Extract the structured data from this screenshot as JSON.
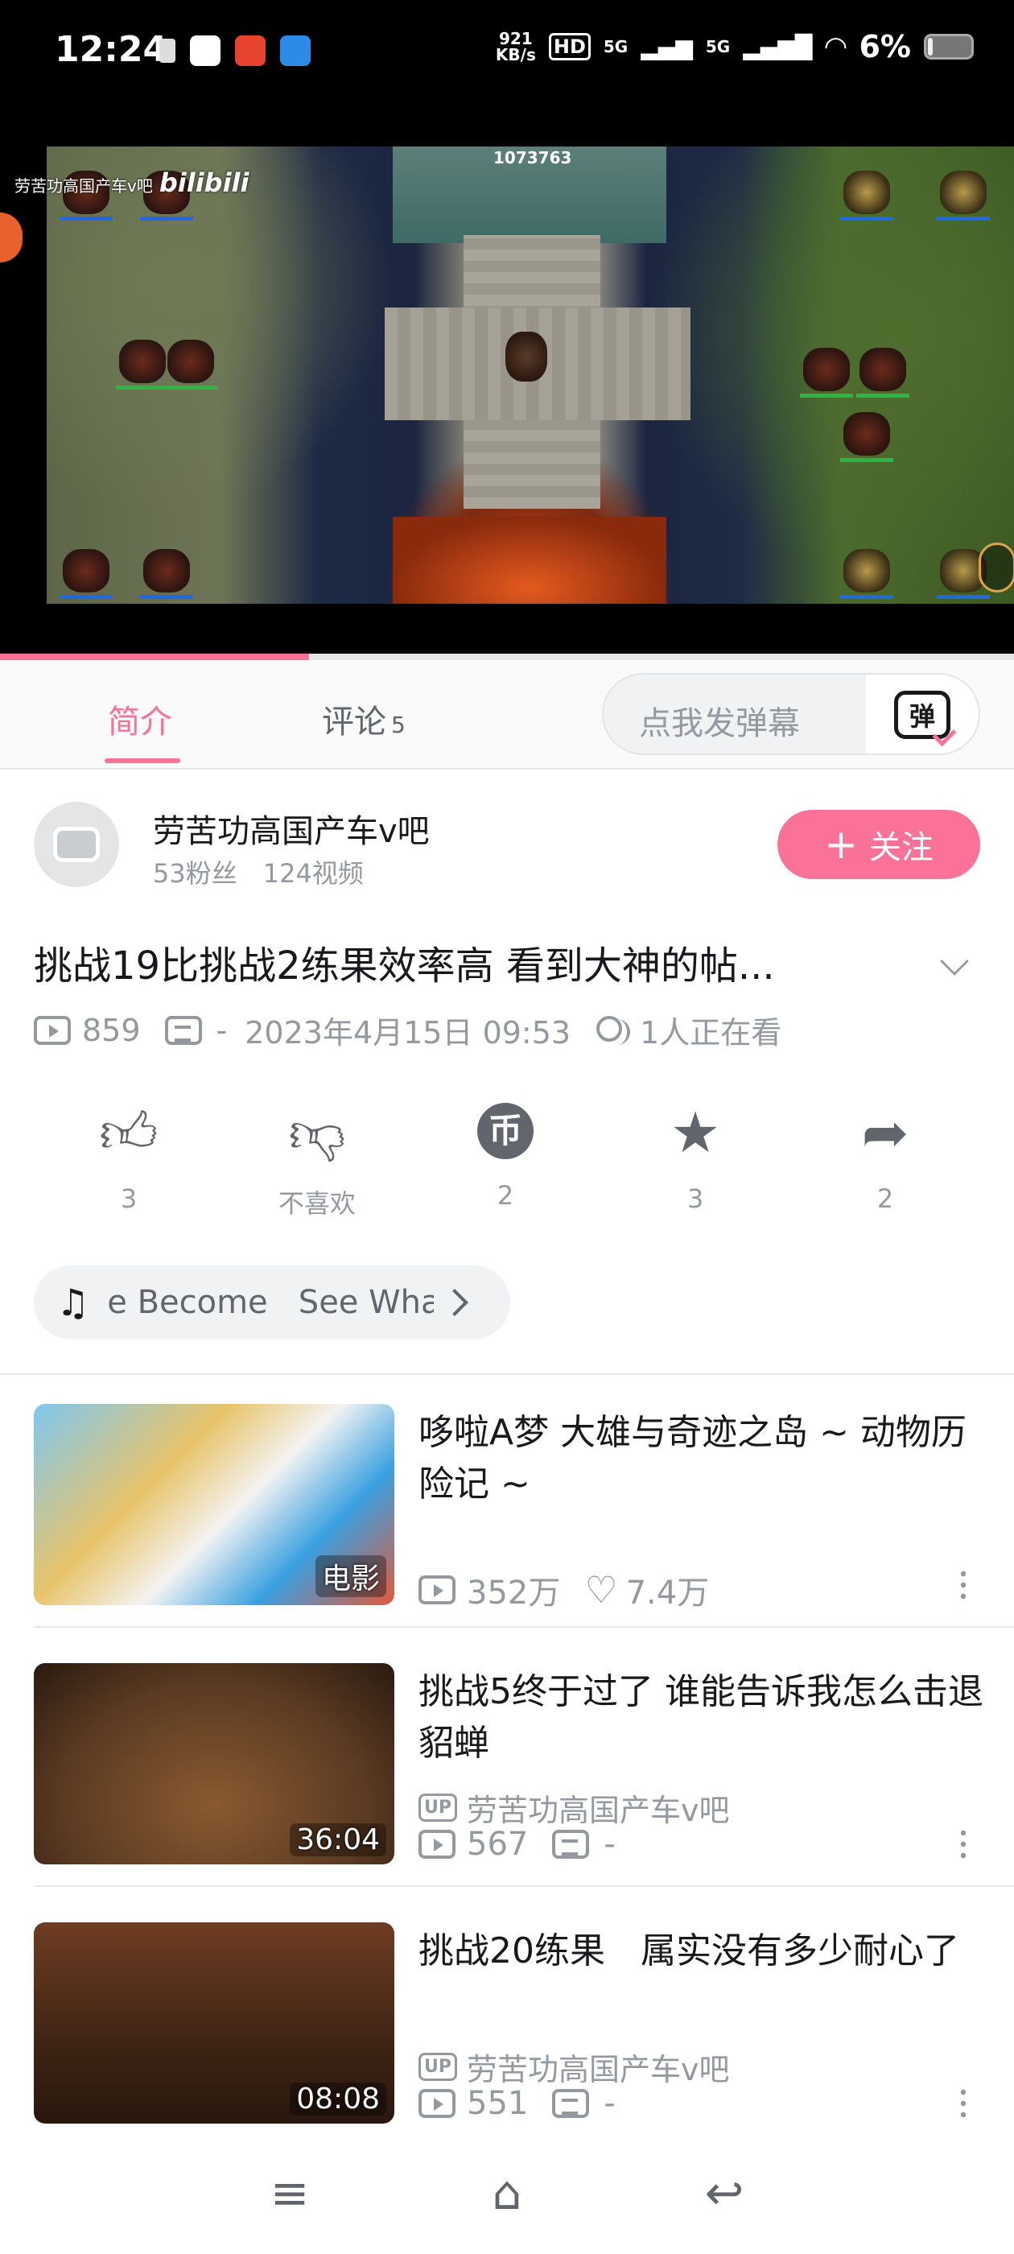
{
  "status_bar": {
    "time": "12:24",
    "net_speed_top": "921",
    "net_speed_unit": "KB/s",
    "hd": "HD",
    "signal1": "5G",
    "signal2": "5G",
    "battery": "6%"
  },
  "player": {
    "watermark": "劳苦功高国产车v吧",
    "watermark_logo": "bilibili",
    "overlay_number": "1073763",
    "progress_fraction": 0.305
  },
  "tabs": {
    "intro": "简介",
    "comments": "评论",
    "comments_count": "5",
    "danmaku_placeholder": "点我发弹幕",
    "danmaku_icon_char": "弹"
  },
  "author": {
    "name": "劳苦功高国产车v吧",
    "fans": "53粉丝",
    "videos": "124视频",
    "follow_label": "关注",
    "follow_plus": "+"
  },
  "video": {
    "title": "挑战19比挑战2练果效率高 看到大神的帖...",
    "views": "859",
    "danmaku": "-",
    "date": "2023年4月15日 09:53",
    "watching": "1人正在看"
  },
  "actions": [
    {
      "icon": "like-icon",
      "label": "3"
    },
    {
      "icon": "dislike-icon",
      "label": "不喜欢"
    },
    {
      "icon": "coin-icon",
      "label": "2"
    },
    {
      "icon": "favorite-icon",
      "label": "3"
    },
    {
      "icon": "share-icon",
      "label": "2"
    }
  ],
  "music": {
    "text": "e Become   See Wha"
  },
  "recommendations": [
    {
      "title": "哆啦A梦 大雄与奇迹之岛 ~ 动物历险记 ~",
      "badge": "电影",
      "views": "352万",
      "likes": "7.4万"
    },
    {
      "title": "挑战5终于过了 谁能告诉我怎么击退貂蝉",
      "duration": "36:04",
      "up_tag": "UP",
      "uploader": "劳苦功高国产车v吧",
      "views": "567",
      "danmaku": "-"
    },
    {
      "title": "挑战20练果　属实没有多少耐心了",
      "duration": "08:08",
      "up_tag": "UP",
      "uploader": "劳苦功高国产车v吧",
      "views": "551",
      "danmaku": "-"
    }
  ],
  "colors": {
    "accent": "#fb7299",
    "text": "#18191c",
    "muted": "#9499a0"
  }
}
